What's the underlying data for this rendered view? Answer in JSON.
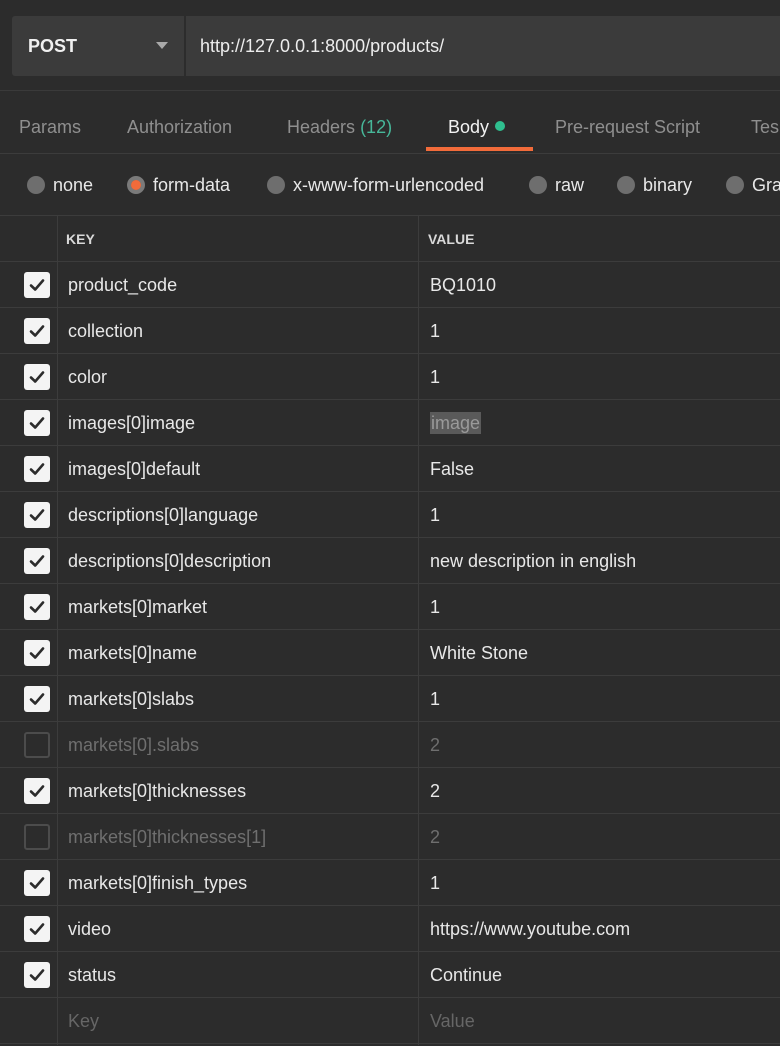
{
  "request": {
    "method": "POST",
    "url": "http://127.0.0.1:8000/products/"
  },
  "tabs": [
    {
      "label": "Params"
    },
    {
      "label": "Authorization"
    },
    {
      "label": "Headers",
      "count": "(12)"
    },
    {
      "label": "Body"
    },
    {
      "label": "Pre-request Script"
    },
    {
      "label": "Tes"
    }
  ],
  "body_types": [
    "none",
    "form-data",
    "x-www-form-urlencoded",
    "raw",
    "binary",
    "Gra"
  ],
  "selected_body_type": "form-data",
  "table": {
    "headers": {
      "key": "KEY",
      "value": "VALUE"
    },
    "rows": [
      {
        "checked": true,
        "key": "product_code",
        "value": "BQ1010"
      },
      {
        "checked": true,
        "key": "collection",
        "value": "1"
      },
      {
        "checked": true,
        "key": "color",
        "value": "1"
      },
      {
        "checked": true,
        "key": "images[0]image",
        "value": "image",
        "type": "file"
      },
      {
        "checked": true,
        "key": "images[0]default",
        "value": "False"
      },
      {
        "checked": true,
        "key": "descriptions[0]language",
        "value": "1"
      },
      {
        "checked": true,
        "key": "descriptions[0]description",
        "value": "new description in english"
      },
      {
        "checked": true,
        "key": "markets[0]market",
        "value": "1"
      },
      {
        "checked": true,
        "key": "markets[0]name",
        "value": "White Stone"
      },
      {
        "checked": true,
        "key": "markets[0]slabs",
        "value": "1"
      },
      {
        "checked": false,
        "key": "markets[0].slabs",
        "value": "2"
      },
      {
        "checked": true,
        "key": "markets[0]thicknesses",
        "value": "2"
      },
      {
        "checked": false,
        "key": "markets[0]thicknesses[1]",
        "value": "2"
      },
      {
        "checked": true,
        "key": "markets[0]finish_types",
        "value": "1"
      },
      {
        "checked": true,
        "key": "video",
        "value": "https://www.youtube.com"
      },
      {
        "checked": true,
        "key": "status",
        "value": "Continue"
      }
    ],
    "new_row": {
      "key_placeholder": "Key",
      "value_placeholder": "Value"
    }
  },
  "colors": {
    "accent": "#f26b3a",
    "active_dot": "#2fbf8f",
    "count": "#47b89a",
    "background": "#2c2c2c"
  }
}
